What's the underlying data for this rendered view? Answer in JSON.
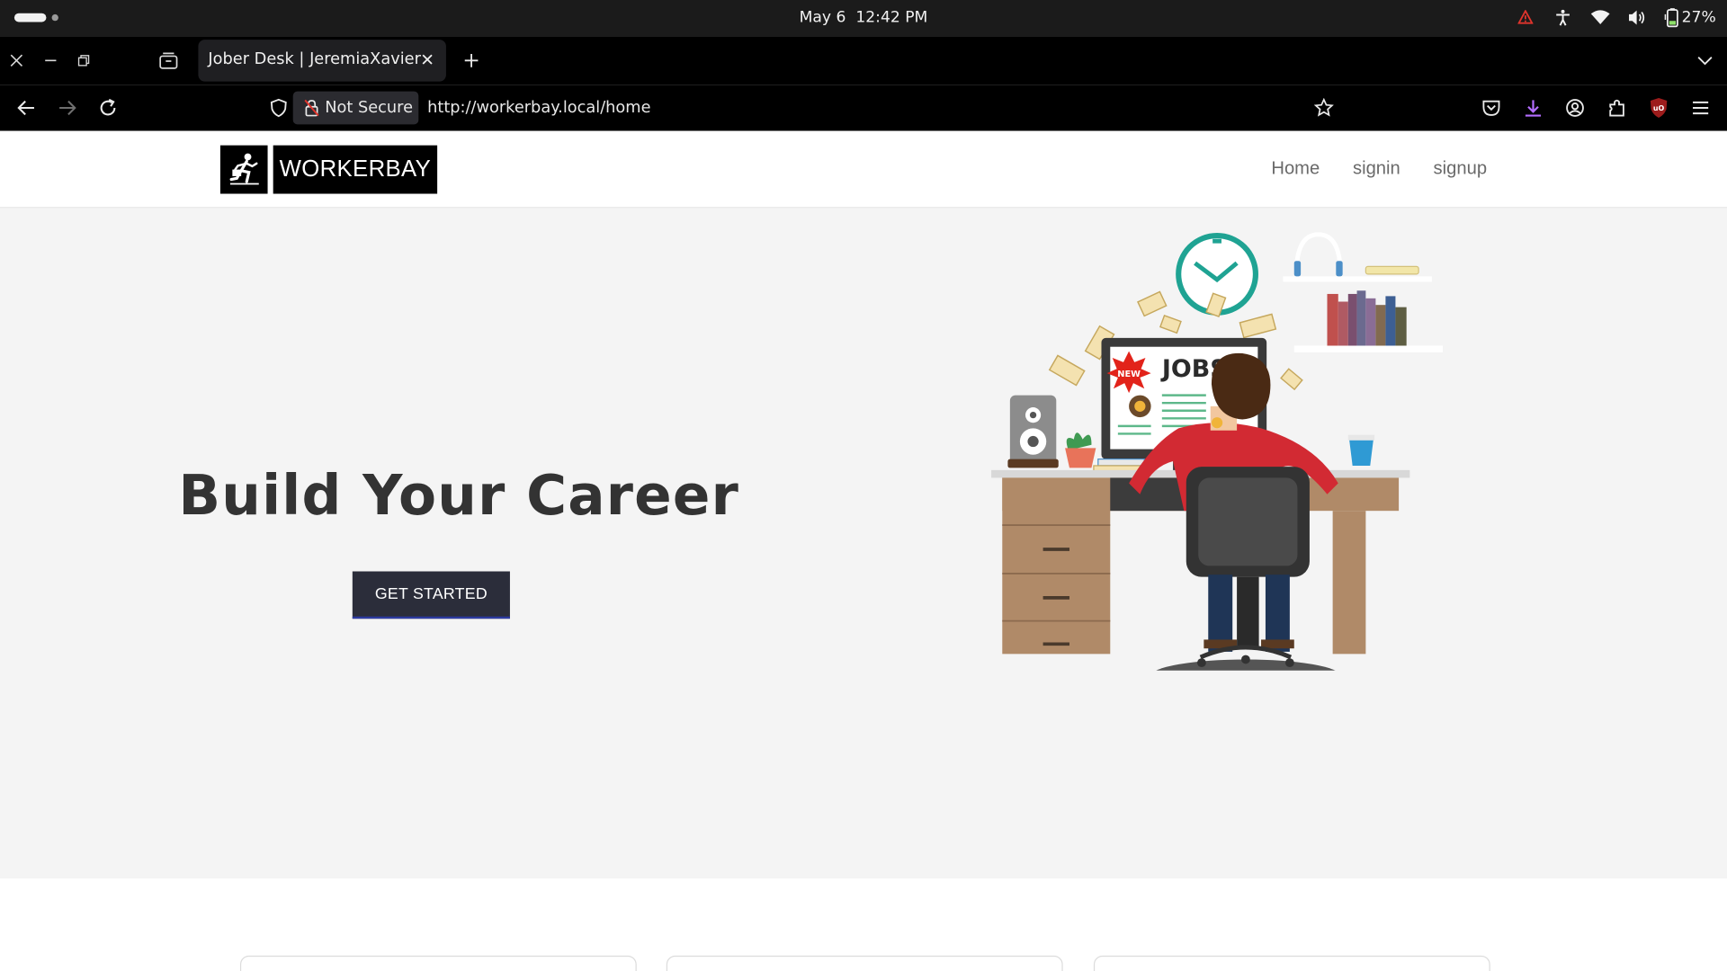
{
  "system": {
    "date": "May 6",
    "time": "12:42 PM",
    "battery": "27%"
  },
  "browser": {
    "tab_title": "Jober Desk | JeremiaXavier",
    "security_label": "Not Secure",
    "url": "http://workerbay.local/home"
  },
  "site": {
    "logo_text": "WORKERBAY",
    "nav": {
      "home": "Home",
      "signin": "signin",
      "signup": "signup"
    }
  },
  "hero": {
    "title": "Build Your Career",
    "cta_label": "GET STARTED",
    "illustration_text": "JOBS",
    "badge_text": "NEW"
  },
  "colors": {
    "cta_bg": "#2b2d3a",
    "hero_bg": "#f4f4f4",
    "title": "#333333"
  }
}
